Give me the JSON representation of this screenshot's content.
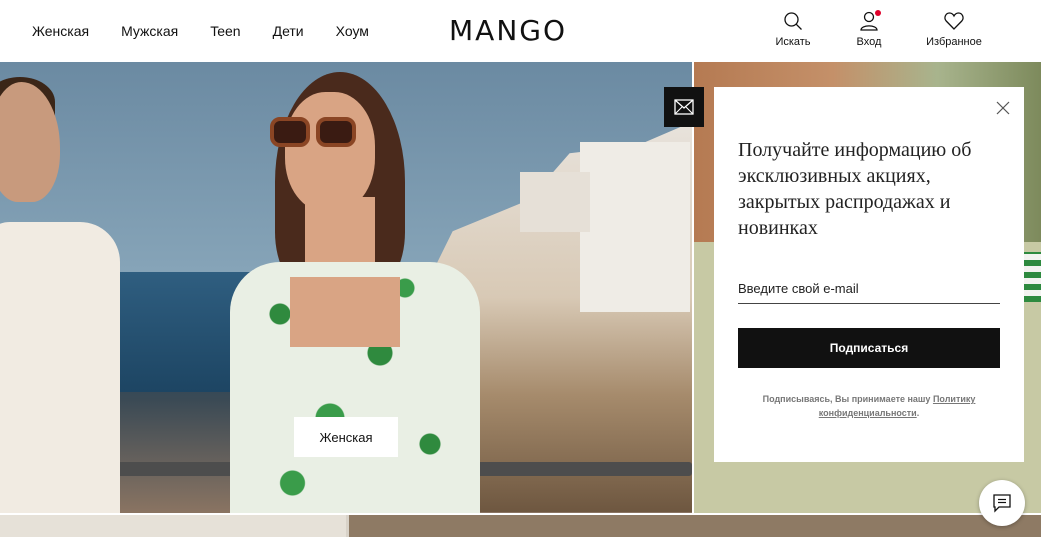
{
  "nav": {
    "items": [
      {
        "label": "Женская"
      },
      {
        "label": "Мужская"
      },
      {
        "label": "Teen"
      },
      {
        "label": "Дети"
      },
      {
        "label": "Хоум"
      }
    ]
  },
  "brand": {
    "logo": "MANGO"
  },
  "actions": {
    "search_label": "Искать",
    "login_label": "Вход",
    "favorites_label": "Избранное"
  },
  "hero": {
    "category_button": "Женская"
  },
  "newsletter": {
    "title": "Получайте информацию об эксклюзивных акциях, закрытых распродажах и новинках",
    "email_placeholder": "Введите свой e-mail",
    "email_value": "",
    "subscribe_label": "Подписаться",
    "legal_prefix": "Подписываясь, Вы принимаете нашу ",
    "legal_link": "Политику конфиденциальности",
    "legal_suffix": "."
  },
  "icons": {
    "search": "search-icon",
    "user": "user-icon",
    "heart": "heart-icon",
    "mail": "mail-icon",
    "close": "close-icon",
    "chat": "chat-icon"
  },
  "colors": {
    "accent_dark": "#111111",
    "notification_dot": "#e0002a"
  }
}
